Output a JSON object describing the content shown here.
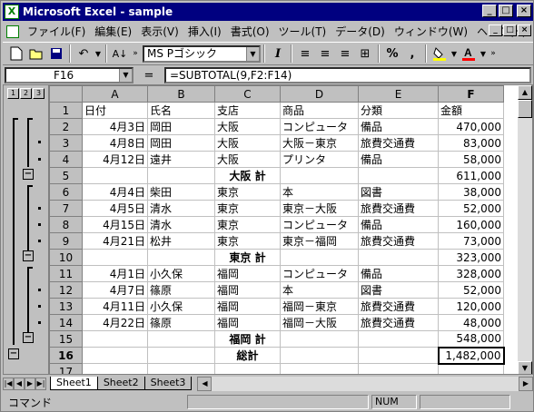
{
  "window": {
    "title": "Microsoft Excel - sample",
    "min": "_",
    "max": "□",
    "close": "×"
  },
  "menu": [
    {
      "label": "ファイル(F)"
    },
    {
      "label": "編集(E)"
    },
    {
      "label": "表示(V)"
    },
    {
      "label": "挿入(I)"
    },
    {
      "label": "書式(O)"
    },
    {
      "label": "ツール(T)"
    },
    {
      "label": "データ(D)"
    },
    {
      "label": "ウィンドウ(W)"
    },
    {
      "label": "ヘルプ(H)"
    }
  ],
  "toolbar": {
    "font_name": "MS Pゴシック",
    "italic": "I",
    "percent": "%",
    "comma": ","
  },
  "formula_bar": {
    "cell_ref": "F16",
    "equals": "=",
    "formula": "=SUBTOTAL(9,F2:F14)"
  },
  "columns": [
    "A",
    "B",
    "C",
    "D",
    "E",
    "F"
  ],
  "outline_levels": [
    "1",
    "2",
    "3"
  ],
  "rows": [
    {
      "n": "1",
      "a": "日付",
      "b": "氏名",
      "c": "支店",
      "d": "商品",
      "e": "分類",
      "f": "金額",
      "f_align": "left"
    },
    {
      "n": "2",
      "a": "4月3日",
      "b": "岡田",
      "c": "大阪",
      "d": "コンピュータ",
      "e": "備品",
      "f": "470,000"
    },
    {
      "n": "3",
      "a": "4月8日",
      "b": "岡田",
      "c": "大阪",
      "d": "大阪－東京",
      "e": "旅費交通費",
      "f": "83,000"
    },
    {
      "n": "4",
      "a": "4月12日",
      "b": "遠井",
      "c": "大阪",
      "d": "プリンタ",
      "e": "備品",
      "f": "58,000"
    },
    {
      "n": "5",
      "a": "",
      "b": "",
      "c": "大阪 計",
      "d": "",
      "e": "",
      "f": "611,000",
      "bold_c": true
    },
    {
      "n": "6",
      "a": "4月4日",
      "b": "柴田",
      "c": "東京",
      "d": "本",
      "e": "図書",
      "f": "38,000"
    },
    {
      "n": "7",
      "a": "4月5日",
      "b": "清水",
      "c": "東京",
      "d": "東京－大阪",
      "e": "旅費交通費",
      "f": "52,000"
    },
    {
      "n": "8",
      "a": "4月15日",
      "b": "清水",
      "c": "東京",
      "d": "コンピュータ",
      "e": "備品",
      "f": "160,000"
    },
    {
      "n": "9",
      "a": "4月21日",
      "b": "松井",
      "c": "東京",
      "d": "東京－福岡",
      "e": "旅費交通費",
      "f": "73,000"
    },
    {
      "n": "10",
      "a": "",
      "b": "",
      "c": "東京 計",
      "d": "",
      "e": "",
      "f": "323,000",
      "bold_c": true
    },
    {
      "n": "11",
      "a": "4月1日",
      "b": "小久保",
      "c": "福岡",
      "d": "コンピュータ",
      "e": "備品",
      "f": "328,000"
    },
    {
      "n": "12",
      "a": "4月7日",
      "b": "篠原",
      "c": "福岡",
      "d": "本",
      "e": "図書",
      "f": "52,000"
    },
    {
      "n": "13",
      "a": "4月11日",
      "b": "小久保",
      "c": "福岡",
      "d": "福岡－東京",
      "e": "旅費交通費",
      "f": "120,000"
    },
    {
      "n": "14",
      "a": "4月22日",
      "b": "篠原",
      "c": "福岡",
      "d": "福岡－大阪",
      "e": "旅費交通費",
      "f": "48,000"
    },
    {
      "n": "15",
      "a": "",
      "b": "",
      "c": "福岡 計",
      "d": "",
      "e": "",
      "f": "548,000",
      "bold_c": true
    },
    {
      "n": "16",
      "a": "",
      "b": "",
      "c": "総計",
      "d": "",
      "e": "",
      "f": "1,482,000",
      "bold_c": true,
      "selected": true
    },
    {
      "n": "17",
      "a": "",
      "b": "",
      "c": "",
      "d": "",
      "e": "",
      "f": ""
    }
  ],
  "sheets": [
    "Sheet1",
    "Sheet2",
    "Sheet3"
  ],
  "status": {
    "mode": "コマンド",
    "num": "NUM"
  }
}
